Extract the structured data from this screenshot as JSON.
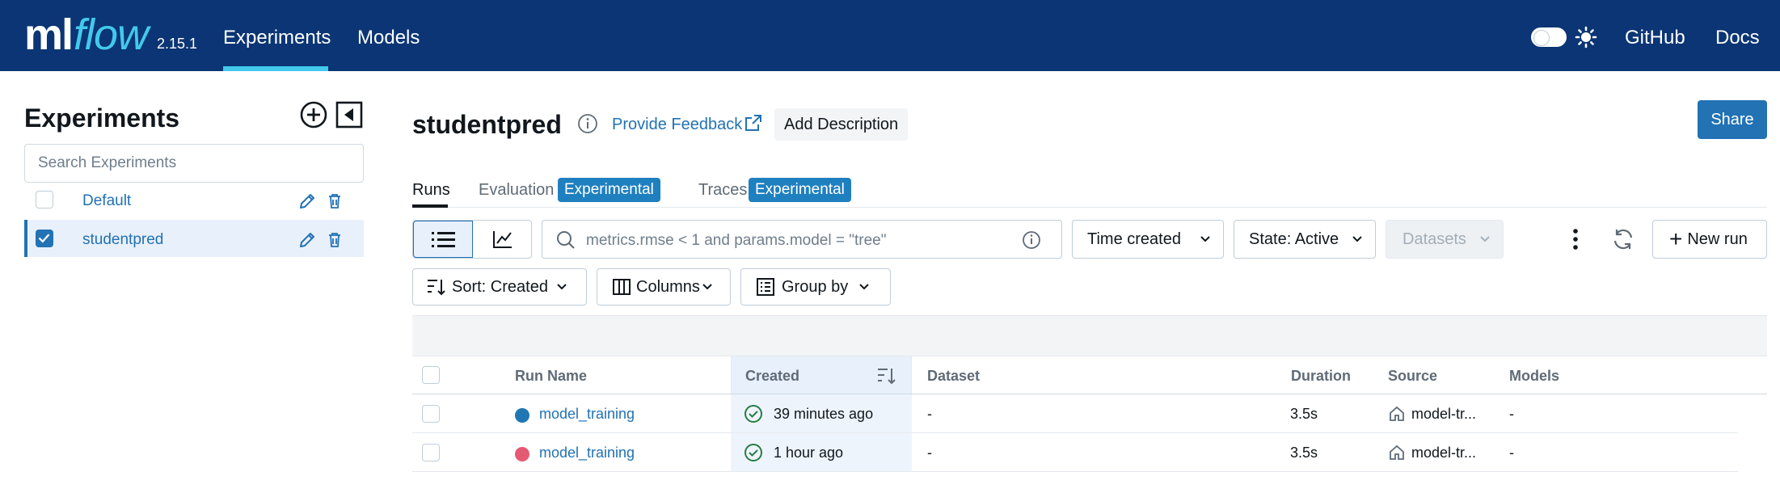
{
  "header": {
    "logo_ml": "ml",
    "logo_flow": "flow",
    "version": "2.15.1",
    "nav": [
      "Experiments",
      "Models"
    ],
    "links": [
      "GitHub",
      "Docs"
    ],
    "theme_icon": "sun-icon"
  },
  "sidebar": {
    "title": "Experiments",
    "search_placeholder": "Search Experiments",
    "experiments": [
      {
        "name": "Default",
        "checked": false
      },
      {
        "name": "studentpred",
        "checked": true
      }
    ]
  },
  "main": {
    "title": "studentpred",
    "feedback": "Provide Feedback",
    "add_description": "Add Description",
    "share": "Share",
    "tabs": {
      "runs": "Runs",
      "evaluation": "Evaluation",
      "evaluation_badge": "Experimental",
      "traces": "Traces",
      "traces_badge": "Experimental"
    },
    "toolbar": {
      "filter_placeholder": "metrics.rmse < 1 and params.model = \"tree\"",
      "time_created": "Time created",
      "state": "State: Active",
      "datasets": "Datasets",
      "new_run": "New run",
      "sort": "Sort: Created",
      "columns": "Columns",
      "group_by": "Group by"
    },
    "table": {
      "columns": [
        "Run Name",
        "Created",
        "Dataset",
        "Duration",
        "Source",
        "Models"
      ],
      "rows": [
        {
          "run_name": "model_training",
          "color": "#1f77b4",
          "created": "39 minutes ago",
          "dataset": "-",
          "duration": "3.5s",
          "source": "model-tr...",
          "models": "-"
        },
        {
          "run_name": "model_training",
          "color": "#e55a73",
          "created": "1 hour ago",
          "dataset": "-",
          "duration": "3.5s",
          "source": "model-tr...",
          "models": "-"
        }
      ]
    }
  },
  "colors": {
    "header_bg": "#0b3574",
    "accent": "#43c9ed",
    "primary": "#2272b4",
    "badge": "#1f80c0",
    "success": "#277c43"
  }
}
